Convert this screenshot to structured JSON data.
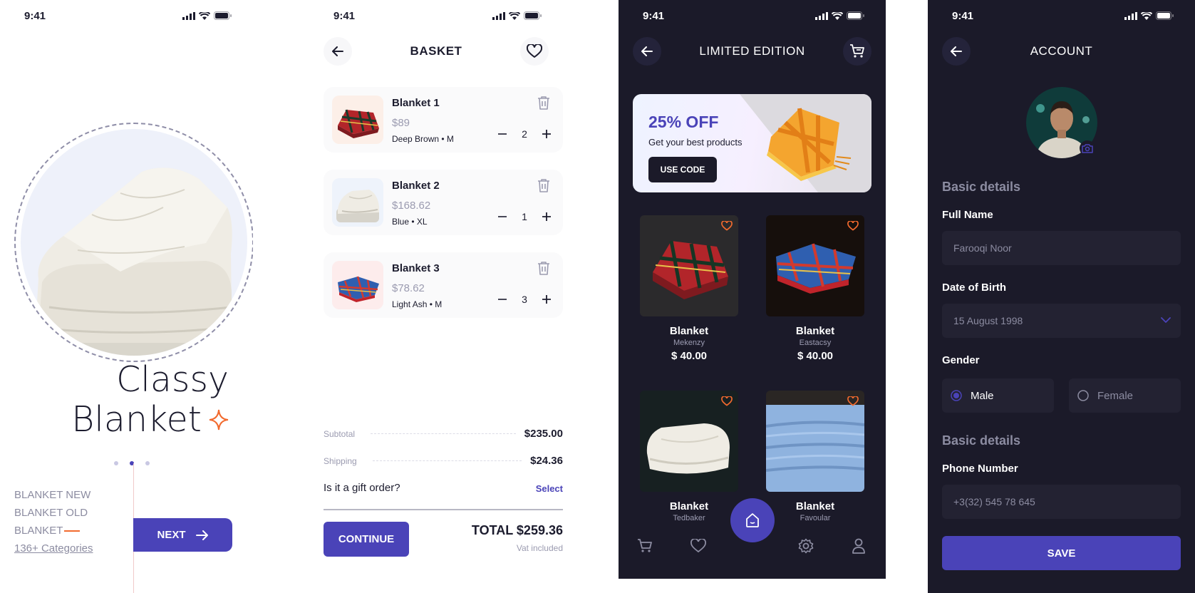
{
  "status": {
    "time": "9:41"
  },
  "onboarding": {
    "title_line1": "Classy",
    "title_line2": "Blanket",
    "categories": [
      "BLANKET NEW",
      "BLANKET OLD",
      "BLANKET"
    ],
    "categories_link": "136+ Categories",
    "next_label": "NEXT",
    "page_indicator": {
      "count": 3,
      "active": 2
    }
  },
  "basket": {
    "title": "BASKET",
    "items": [
      {
        "name": "Blanket 1",
        "price": "$89",
        "variant": "Deep Brown • M",
        "qty": "2"
      },
      {
        "name": "Blanket 2",
        "price": "$168.62",
        "variant": "Blue • XL",
        "qty": "1"
      },
      {
        "name": "Blanket 3",
        "price": "$78.62",
        "variant": "Light Ash • M",
        "qty": "3"
      }
    ],
    "subtotal_label": "Subtotal",
    "subtotal": "$235.00",
    "shipping_label": "Shipping",
    "shipping": "$24.36",
    "gift_question": "Is it a gift order?",
    "gift_action": "Select",
    "continue_label": "CONTINUE",
    "total": "TOTAL $259.36",
    "vat_note": "Vat included"
  },
  "limited": {
    "title": "LIMITED EDITION",
    "promo_title": "25% OFF",
    "promo_sub": "Get your best products",
    "promo_button": "USE CODE",
    "products": [
      {
        "name": "Blanket",
        "brand": "Mekenzy",
        "price": "$ 40.00"
      },
      {
        "name": "Blanket",
        "brand": "Eastacsy",
        "price": "$ 40.00"
      },
      {
        "name": "Blanket",
        "brand": "Tedbaker",
        "price": ""
      },
      {
        "name": "Blanket",
        "brand": "Favoular",
        "price": ""
      }
    ]
  },
  "account": {
    "title": "ACCOUNT",
    "section1": "Basic details",
    "full_name_label": "Full Name",
    "full_name_placeholder": "Farooqi Noor",
    "dob_label": "Date of Birth",
    "dob_value": "15 August 1998",
    "gender_label": "Gender",
    "gender_options": [
      "Male",
      "Female"
    ],
    "gender_selected": "Male",
    "section2": "Basic details",
    "phone_label": "Phone Number",
    "phone_placeholder": "+3(32) 545 78 645",
    "save_label": "SAVE"
  },
  "colors": {
    "accent": "#4a43b8",
    "dark_bg": "#1b1a29",
    "heart": "#f26a2e",
    "field_bg": "#232232"
  }
}
